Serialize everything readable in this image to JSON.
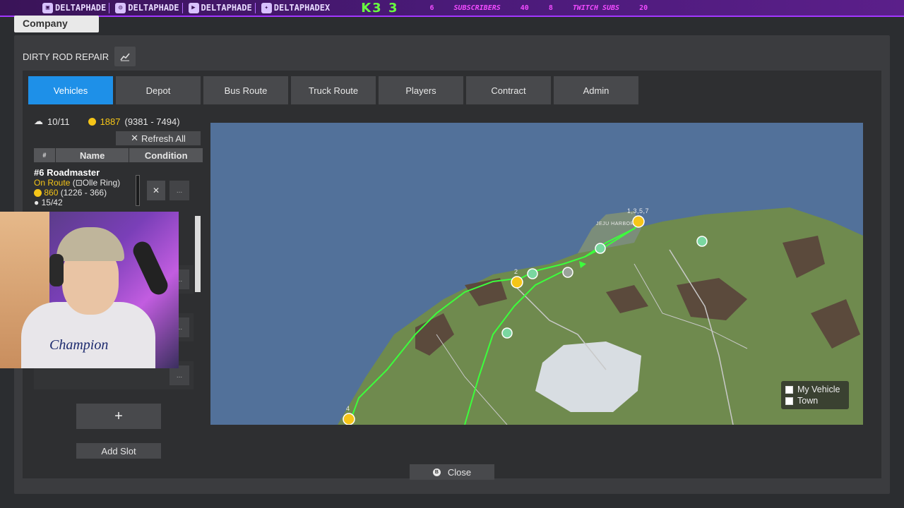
{
  "overlay": {
    "socials": [
      {
        "icon": "twitch-icon",
        "handle": "DELTAPHADE"
      },
      {
        "icon": "instagram-icon",
        "handle": "DELTAPHADE"
      },
      {
        "icon": "youtube-icon",
        "handle": "DELTAPHADE"
      },
      {
        "icon": "twitter-icon",
        "handle": "DELTAPHADEX"
      }
    ],
    "badge": "K3 3",
    "stats": {
      "a": "6",
      "subscribers_label": "SUBSCRIBERS",
      "subscribers_value": "40",
      "b": "8",
      "twitch_subs_label": "TWITCH SUBS",
      "twitch_subs_value": "20"
    }
  },
  "company_tab": "Company",
  "header": {
    "title": "DIRTY ROD REPAIR"
  },
  "tabs": [
    "Vehicles",
    "Depot",
    "Bus Route",
    "Truck Route",
    "Players",
    "Contract",
    "Admin"
  ],
  "active_tab": "Vehicles",
  "summary": {
    "vehicles": "10/11",
    "money": "1887",
    "money_range": "(9381 - 7494)"
  },
  "refresh_label": "Refresh All",
  "table": {
    "col_num": "#",
    "col_name": "Name",
    "col_condition": "Condition"
  },
  "vehicle": {
    "name": "#6 Roadmaster",
    "status": "On Route",
    "route": "Olle Ring)",
    "income": "860",
    "income_range": "(1226 - 366)",
    "passengers": "15/42",
    "more": "..."
  },
  "ghost_more": "...",
  "add_plus": "+",
  "add_slot_label": "Add Slot",
  "map": {
    "labels": {
      "harbor": "JEJU HARBOR",
      "markers_top": "1,3,5,7",
      "marker_2": "2",
      "marker_4": "4"
    },
    "legend": [
      "My Vehicle",
      "Town"
    ]
  },
  "close_label": "Close",
  "close_key": "B",
  "colors": {
    "accent": "#1e90e8",
    "gold": "#f5c518",
    "route": "#3cff3c",
    "water": "#52719a",
    "land": "#6f8a4e"
  }
}
